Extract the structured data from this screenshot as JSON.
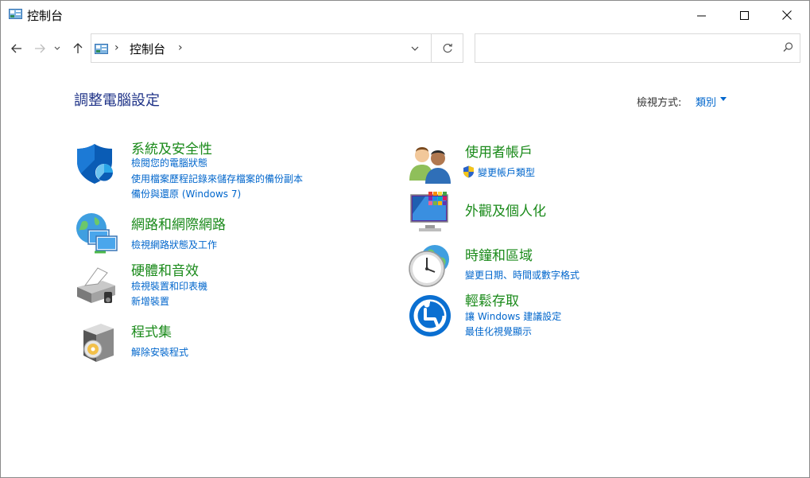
{
  "window": {
    "title": "控制台"
  },
  "address": {
    "crumb": "控制台"
  },
  "search": {
    "placeholder": ""
  },
  "header": {
    "title": "調整電腦設定",
    "view_by_label": "檢視方式:",
    "view_by_value": "類別"
  },
  "categories": {
    "system_security": {
      "title": "系統及安全性",
      "links": [
        "檢閱您的電腦狀態",
        "使用檔案歷程記錄來儲存檔案的備份副本",
        "備份與還原 (Windows 7)"
      ]
    },
    "network": {
      "title": "網路和網際網路",
      "links": [
        "檢視網路狀態及工作"
      ]
    },
    "hardware_sound": {
      "title": "硬體和音效",
      "links": [
        "檢視裝置和印表機",
        "新增裝置"
      ]
    },
    "programs": {
      "title": "程式集",
      "links": [
        "解除安裝程式"
      ]
    },
    "user_accounts": {
      "title": "使用者帳戶",
      "links": [
        "變更帳戶類型"
      ]
    },
    "appearance": {
      "title": "外觀及個人化"
    },
    "clock_region": {
      "title": "時鐘和區域",
      "links": [
        "變更日期、時間或數字格式"
      ]
    },
    "ease_of_access": {
      "title": "輕鬆存取",
      "links": [
        "讓 Windows 建議設定",
        "最佳化視覺顯示"
      ]
    }
  },
  "colors": {
    "link": "#0066cc",
    "category_title": "#1a8a1a",
    "page_title": "#1e3287"
  }
}
